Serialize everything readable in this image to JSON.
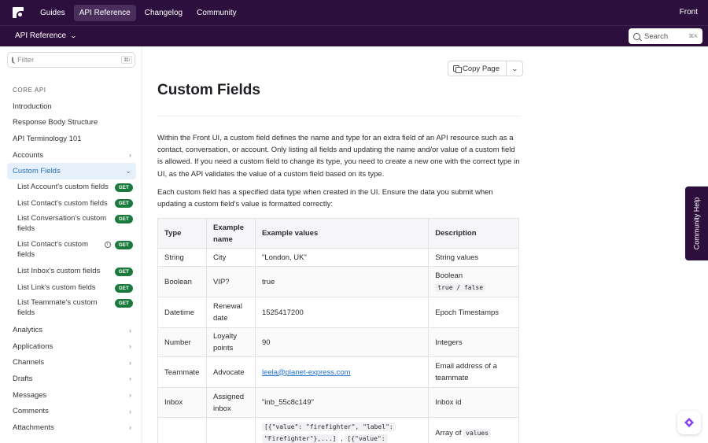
{
  "topnav": {
    "links": [
      {
        "label": "Guides",
        "active": false
      },
      {
        "label": "API Reference",
        "active": true
      },
      {
        "label": "Changelog",
        "active": false
      },
      {
        "label": "Community",
        "active": false
      }
    ],
    "brand": "Front"
  },
  "subnav": {
    "section_label": "API Reference",
    "search_label": "Search",
    "search_shortcut": "⌘K"
  },
  "sidebar": {
    "filter_placeholder": "Filter",
    "filter_shortcut": "⌘/",
    "section_title": "CORE API",
    "items_top": [
      "Introduction",
      "Response Body Structure",
      "API Terminology 101",
      "Accounts"
    ],
    "open_item": "Custom Fields",
    "badge": "GET",
    "sub_items": [
      "List Account's custom fields",
      "List Contact's custom fields",
      "List Conversation's custom fields",
      "List Contact's custom fields",
      "List Inbox's custom fields",
      "List Link's custom fields",
      "List Teammate's custom fields"
    ],
    "items_bottom": [
      "Analytics",
      "Applications",
      "Channels",
      "Drafts",
      "Messages",
      "Comments",
      "Attachments"
    ]
  },
  "main": {
    "copy_label": "Copy Page",
    "title": "Custom Fields",
    "paragraph1": "Within the Front UI, a custom field defines the name and type for an extra field of an API resource such as a contact, conversation, or account. Only listing all fields and updating the name and/or value of a custom field is allowed. If you need a custom field to change its type, you need to create a new one with the correct type in UI, as the API validates the value of a custom field based on its type.",
    "paragraph2": "Each custom field has a specified data type when created in the UI. Ensure the data you submit when updating a custom field's value is formatted correctly:",
    "table": {
      "headers": [
        "Type",
        "Example name",
        "Example values",
        "Description"
      ],
      "rows": [
        {
          "type": "String",
          "name": "City",
          "value": "\"London, UK\"",
          "desc": "String values"
        },
        {
          "type": "Boolean",
          "name": "VIP?",
          "value": "true",
          "desc": "Boolean",
          "desc_code": "true / false"
        },
        {
          "type": "Datetime",
          "name": "Renewal date",
          "value": "1525417200",
          "desc": "Epoch Timestamps"
        },
        {
          "type": "Number",
          "name": "Loyalty points",
          "value": "90",
          "desc": "Integers"
        },
        {
          "type": "Teammate",
          "name": "Advocate",
          "value": "leela@planet-express.com",
          "desc": "Email address of a teammate"
        },
        {
          "type": "Inbox",
          "name": "Assigned inbox",
          "value": "\"inb_55c8c149\"",
          "desc": "Inbox id"
        },
        {
          "type": "",
          "name": "",
          "value_code1": "[{\"value\": \"firefighter\", \"label\":",
          "value_code2": "\"Firefighter\"},...]",
          "value_code3": "[{\"value\":",
          "value_sep": ",",
          "desc": "Array of",
          "desc_code": "values"
        }
      ]
    }
  },
  "floating": {
    "community_help": "Community Help"
  },
  "colors": {
    "nav_bg": "#2c0f3d",
    "active_bg": "#e6f0fb",
    "active_text": "#2a6fb5",
    "badge": "#1a7a3c",
    "link": "#1f6fd1"
  }
}
